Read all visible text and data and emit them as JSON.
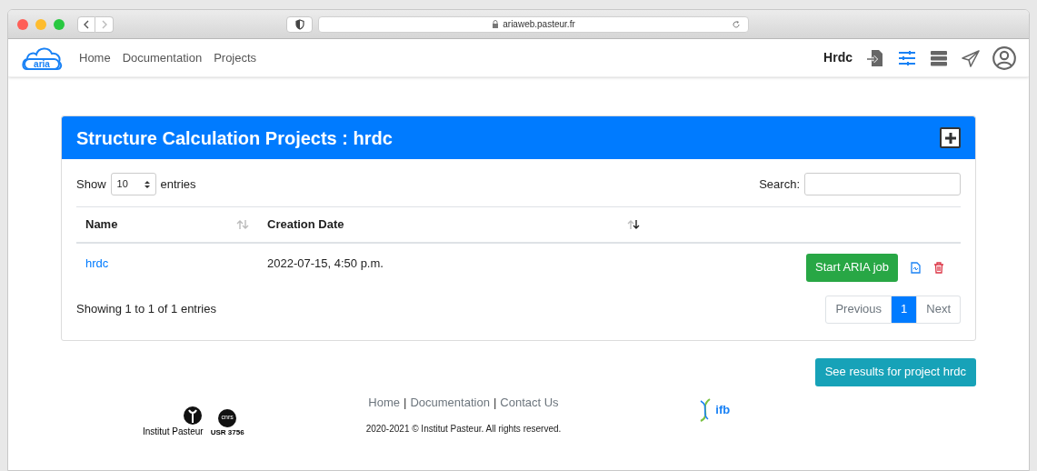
{
  "browser": {
    "url": "ariaweb.pasteur.fr"
  },
  "navbar": {
    "logo_text": "aria",
    "links": [
      {
        "label": "Home"
      },
      {
        "label": "Documentation"
      },
      {
        "label": "Projects"
      }
    ],
    "user": "Hrdc",
    "icons": [
      {
        "kind": "import",
        "active": false
      },
      {
        "kind": "sliders",
        "active": true
      },
      {
        "kind": "server",
        "active": false
      },
      {
        "kind": "send",
        "active": false
      },
      {
        "kind": "account",
        "active": false
      }
    ]
  },
  "card": {
    "title": "Structure Calculation Projects : hrdc",
    "length": {
      "before": "Show",
      "value": "10",
      "after": "entries"
    },
    "search_label": "Search:",
    "table": {
      "columns": [
        {
          "label": "Name",
          "sorted": false
        },
        {
          "label": "Creation Date",
          "sorted": true
        }
      ],
      "rows": [
        {
          "name": "hrdc",
          "date": "2022-07-15, 4:50 p.m.",
          "action": "Start ARIA job"
        }
      ]
    },
    "info": "Showing 1 to 1 of 1 entries",
    "pagination": [
      {
        "label": "Previous",
        "disabled": true,
        "selected": false
      },
      {
        "label": "1",
        "disabled": false,
        "selected": true
      },
      {
        "label": "Next",
        "disabled": true,
        "selected": false
      }
    ]
  },
  "results_button": "See results for project hrdc",
  "footer": {
    "pasteur": {
      "name": "Institut Pasteur",
      "cnrs": "cnrs",
      "unit": "USR 3756"
    },
    "links": [
      {
        "label": "Home"
      },
      {
        "label": "Documentation"
      },
      {
        "label": "Contact Us"
      }
    ],
    "separator": "|",
    "copyright": "2020-2021 © Institut Pasteur. All rights reserved.",
    "ifb": "ifb"
  }
}
